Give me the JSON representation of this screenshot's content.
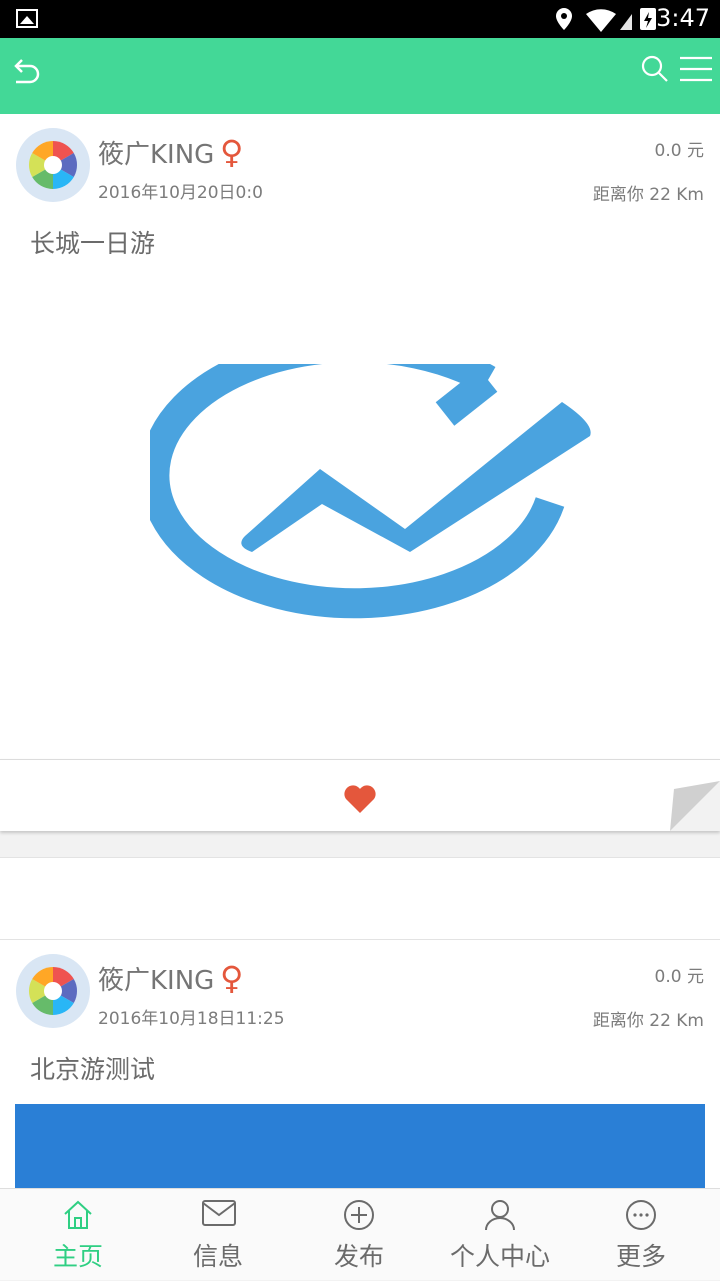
{
  "status_bar": {
    "time": "3:47"
  },
  "app_bar": {
    "back_icon": "back-arrow-icon",
    "search_icon": "search-icon",
    "menu_icon": "menu-icon"
  },
  "colors": {
    "accent": "#43d897",
    "nav_active": "#2fcf83",
    "heart": "#e4573c",
    "logo_blue": "#4aa3df",
    "image_blue": "#2a7fd6"
  },
  "posts": [
    {
      "username": "筱广KING",
      "gender_symbol": "♀",
      "date": "2016年10月20日0:0",
      "price": "0.0 元",
      "distance": "距离你 22 Km",
      "title": "长城一日游"
    },
    {
      "username": "筱广KING",
      "gender_symbol": "♀",
      "date": "2016年10月18日11:25",
      "price": "0.0 元",
      "distance": "距离你 22 Km",
      "title": "北京游测试"
    }
  ],
  "bottom_nav": [
    {
      "label": "主页",
      "icon": "home-icon",
      "active": true
    },
    {
      "label": "信息",
      "icon": "mail-icon",
      "active": false
    },
    {
      "label": "发布",
      "icon": "plus-circle-icon",
      "active": false
    },
    {
      "label": "个人中心",
      "icon": "user-icon",
      "active": false
    },
    {
      "label": "更多",
      "icon": "more-icon",
      "active": false
    }
  ]
}
